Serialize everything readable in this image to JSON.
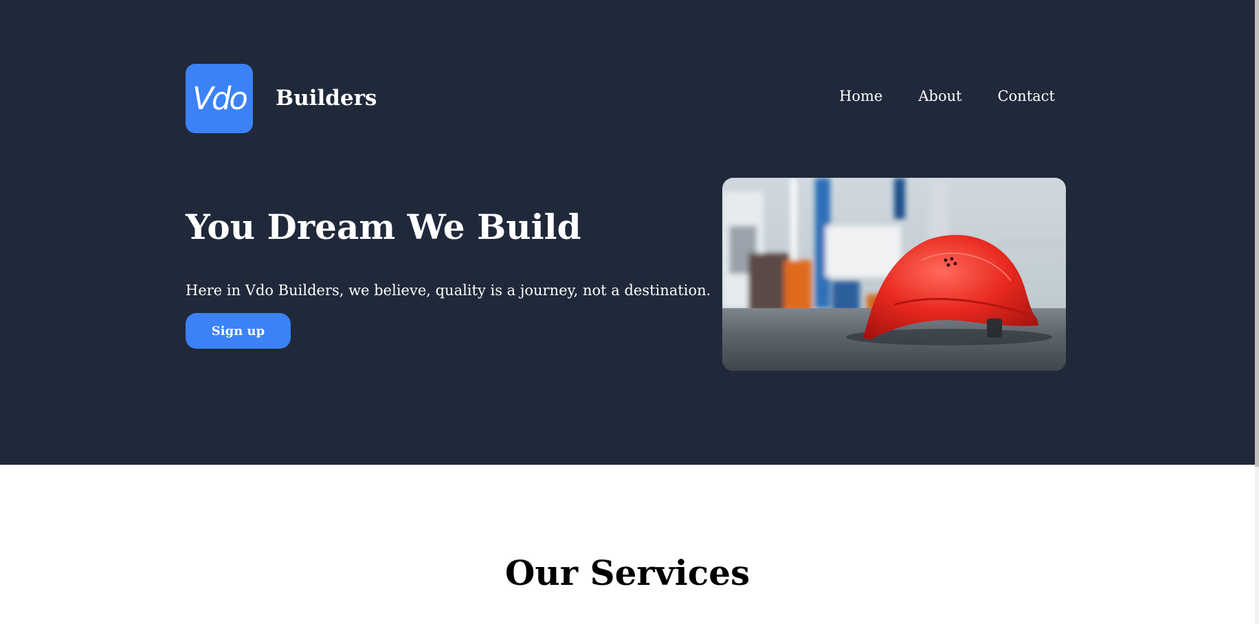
{
  "header": {
    "logo_text": "Vdo",
    "brand_name": "Builders",
    "nav": [
      {
        "label": "Home"
      },
      {
        "label": "About"
      },
      {
        "label": "Contact"
      }
    ]
  },
  "hero": {
    "title": "You Dream We Build",
    "subtitle": "Here in Vdo Builders, we believe, quality is a journey, not a destination.",
    "cta_label": "Sign up",
    "image_icon": "red-hard-hat-on-construction-site"
  },
  "services": {
    "title": "Our Services"
  },
  "colors": {
    "hero_background": "#20293a",
    "accent": "#3b82f6",
    "page_background": "#ffffff"
  }
}
